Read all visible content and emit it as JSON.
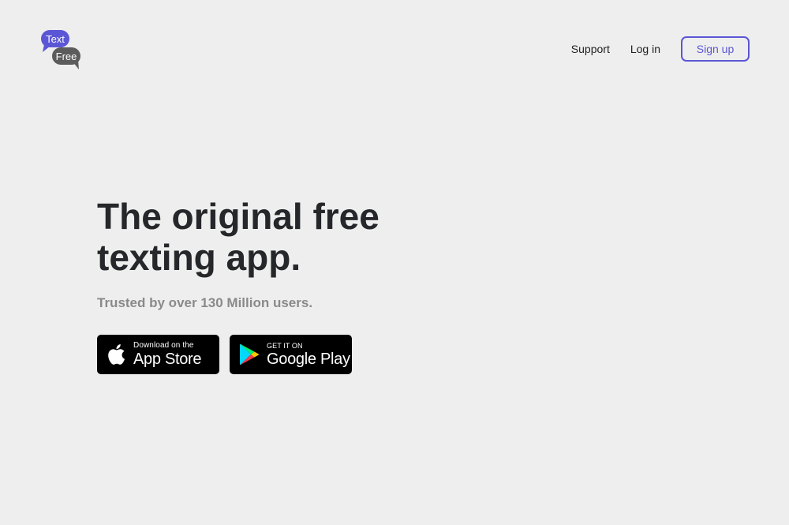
{
  "logo": {
    "line1": "Text",
    "line2": "Free",
    "colors": {
      "top_bubble": "#5b56d6",
      "bottom_bubble": "#5c5c5c"
    }
  },
  "nav": {
    "support": "Support",
    "login": "Log in",
    "signup": "Sign up"
  },
  "hero": {
    "headline_line1": "The original free",
    "headline_line2": "texting app.",
    "subline": "Trusted by over 130 Million users."
  },
  "badges": {
    "app_store": {
      "small": "Download on the",
      "big": "App Store",
      "icon": "apple-icon"
    },
    "google_play": {
      "small": "GET IT ON",
      "big": "Google Play",
      "icon": "google-play-icon"
    }
  },
  "colors": {
    "background": "#eeeeee",
    "accent": "#5b56d6",
    "headline": "#25272a",
    "subline": "#8a8a8a",
    "badge_bg": "#000000"
  }
}
